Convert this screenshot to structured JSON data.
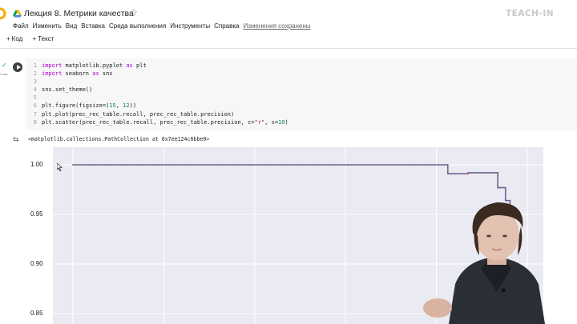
{
  "header": {
    "notebook_title": "Лекция 8. Метрики качества",
    "brand": "TEACH-IN"
  },
  "menu": {
    "items": [
      "Файл",
      "Изменить",
      "Вид",
      "Вставка",
      "Среда выполнения",
      "Инструменты",
      "Справка"
    ],
    "save_status": "Изменения сохранены"
  },
  "toolbar": {
    "code_label": "Код",
    "text_label": "Текст"
  },
  "cell": {
    "lines": [
      {
        "n": "1",
        "tokens": [
          {
            "t": "import",
            "c": "kw"
          },
          {
            "t": " matplotlib.pyplot ",
            "c": "plain"
          },
          {
            "t": "as",
            "c": "kw"
          },
          {
            "t": " plt",
            "c": "plain"
          }
        ]
      },
      {
        "n": "2",
        "tokens": [
          {
            "t": "import",
            "c": "kw"
          },
          {
            "t": " seaborn ",
            "c": "plain"
          },
          {
            "t": "as",
            "c": "kw"
          },
          {
            "t": " sns",
            "c": "plain"
          }
        ]
      },
      {
        "n": "3",
        "tokens": []
      },
      {
        "n": "4",
        "tokens": [
          {
            "t": "sns.set_theme()",
            "c": "plain"
          }
        ]
      },
      {
        "n": "5",
        "tokens": []
      },
      {
        "n": "6",
        "tokens": [
          {
            "t": "plt.figure(figsize=(",
            "c": "plain"
          },
          {
            "t": "15",
            "c": "num"
          },
          {
            "t": ", ",
            "c": "plain"
          },
          {
            "t": "12",
            "c": "num"
          },
          {
            "t": "))",
            "c": "plain"
          }
        ]
      },
      {
        "n": "7",
        "tokens": [
          {
            "t": "plt.plot(prec_rec_table.recall, prec_rec_table.precision)",
            "c": "plain"
          }
        ]
      },
      {
        "n": "8",
        "tokens": [
          {
            "t": "plt.scatter(prec_rec_table.recall, prec_rec_table.precision, c=",
            "c": "plain"
          },
          {
            "t": "\"r\"",
            "c": "str"
          },
          {
            "t": ", s=",
            "c": "plain"
          },
          {
            "t": "10",
            "c": "num"
          },
          {
            "t": ")",
            "c": "plain"
          }
        ]
      }
    ],
    "output": "<matplotlib.collections.PathCollection at 0x7ee124c6bbe0>"
  },
  "chart_data": {
    "type": "line",
    "yticks": [
      "1.00",
      "0.95",
      "0.90",
      "0.85"
    ],
    "ylim": [
      0.84,
      1.018
    ],
    "xlim": [
      0,
      1
    ],
    "grid": true,
    "series": [
      {
        "color": "#4c72b0",
        "marker_color": "#c44e52",
        "points": [
          [
            0.0,
            1.0
          ],
          [
            0.825,
            1.0
          ],
          [
            0.825,
            0.991
          ],
          [
            0.87,
            0.991
          ],
          [
            0.87,
            0.992
          ],
          [
            0.935,
            0.992
          ],
          [
            0.935,
            0.977
          ],
          [
            0.952,
            0.977
          ],
          [
            0.952,
            0.964
          ],
          [
            0.962,
            0.964
          ],
          [
            0.962,
            0.95
          ]
        ]
      }
    ]
  }
}
